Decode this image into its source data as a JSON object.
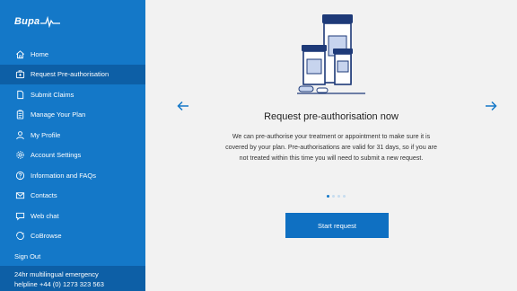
{
  "brand": {
    "logo_text": "Bupa"
  },
  "sidebar": {
    "items": [
      {
        "label": "Home",
        "icon": "home-icon"
      },
      {
        "label": "Request Pre-authorisation",
        "icon": "medical-kit-icon",
        "active": true
      },
      {
        "label": "Submit Claims",
        "icon": "document-icon"
      },
      {
        "label": "Manage Your Plan",
        "icon": "clipboard-icon"
      },
      {
        "label": "My Profile",
        "icon": "user-icon"
      },
      {
        "label": "Account Settings",
        "icon": "gear-icon"
      },
      {
        "label": "Information and FAQs",
        "icon": "help-icon"
      },
      {
        "label": "Contacts",
        "icon": "envelope-icon"
      },
      {
        "label": "Web chat",
        "icon": "chat-icon"
      },
      {
        "label": "CoBrowse",
        "icon": "cobrowse-icon"
      }
    ],
    "signout_label": "Sign Out",
    "emergency_line1": "24hr multilingual emergency",
    "emergency_line2": "helpline +44 (0) 1273 323 563"
  },
  "carousel": {
    "title": "Request pre-authorisation now",
    "body": "We can pre-authorise your treatment or appointment to make sure it is covered by your plan. Pre-authorisations are valid for 31 days, so if you are not treated within this time you will need to submit a new request.",
    "slide_count": 4,
    "active_slide": 1,
    "button_label": "Start request"
  },
  "colors": {
    "sidebar": "#1478c8",
    "sidebar_active": "#0d5fa6",
    "accent": "#0f70c2",
    "background": "#f2f2f2"
  }
}
